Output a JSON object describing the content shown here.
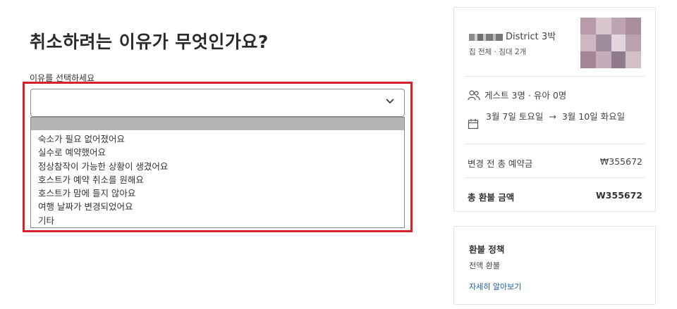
{
  "page": {
    "title": "취소하려는 이유가 무엇인가요?",
    "select_label": "이유를 선택하세요"
  },
  "reason_select": {
    "value": "",
    "icon": "chevron-down-icon",
    "highlight_color": "#d6202c",
    "options": [
      "숙소가 필요 없어졌어요",
      "실수로 예약했어요",
      "정상참작이 가능한 상황이 생겼어요",
      "호스트가 예약 취소를 원해요",
      "호스트가 맘에 들지 않아요",
      "여행 날짜가 변경되었어요",
      "기타"
    ]
  },
  "booking": {
    "listing_name": "District 3박",
    "listing_sub": "집 전체 · 침대 2개",
    "guests": "게스트 3명 · 유아 0명",
    "guests_icon": "users-icon",
    "date_icon": "calendar-icon",
    "checkin": "3월 7일 토요일",
    "arrow": "→",
    "checkout": "3월 10일 화요일",
    "original_price_label": "변경 전 총 예약금",
    "original_price_value": "₩355672",
    "refund_label": "총 환불 금액",
    "refund_value": "W355672"
  },
  "policy": {
    "title": "환불 정책",
    "text": "전액 환불",
    "link": "자세히 알아보기"
  }
}
